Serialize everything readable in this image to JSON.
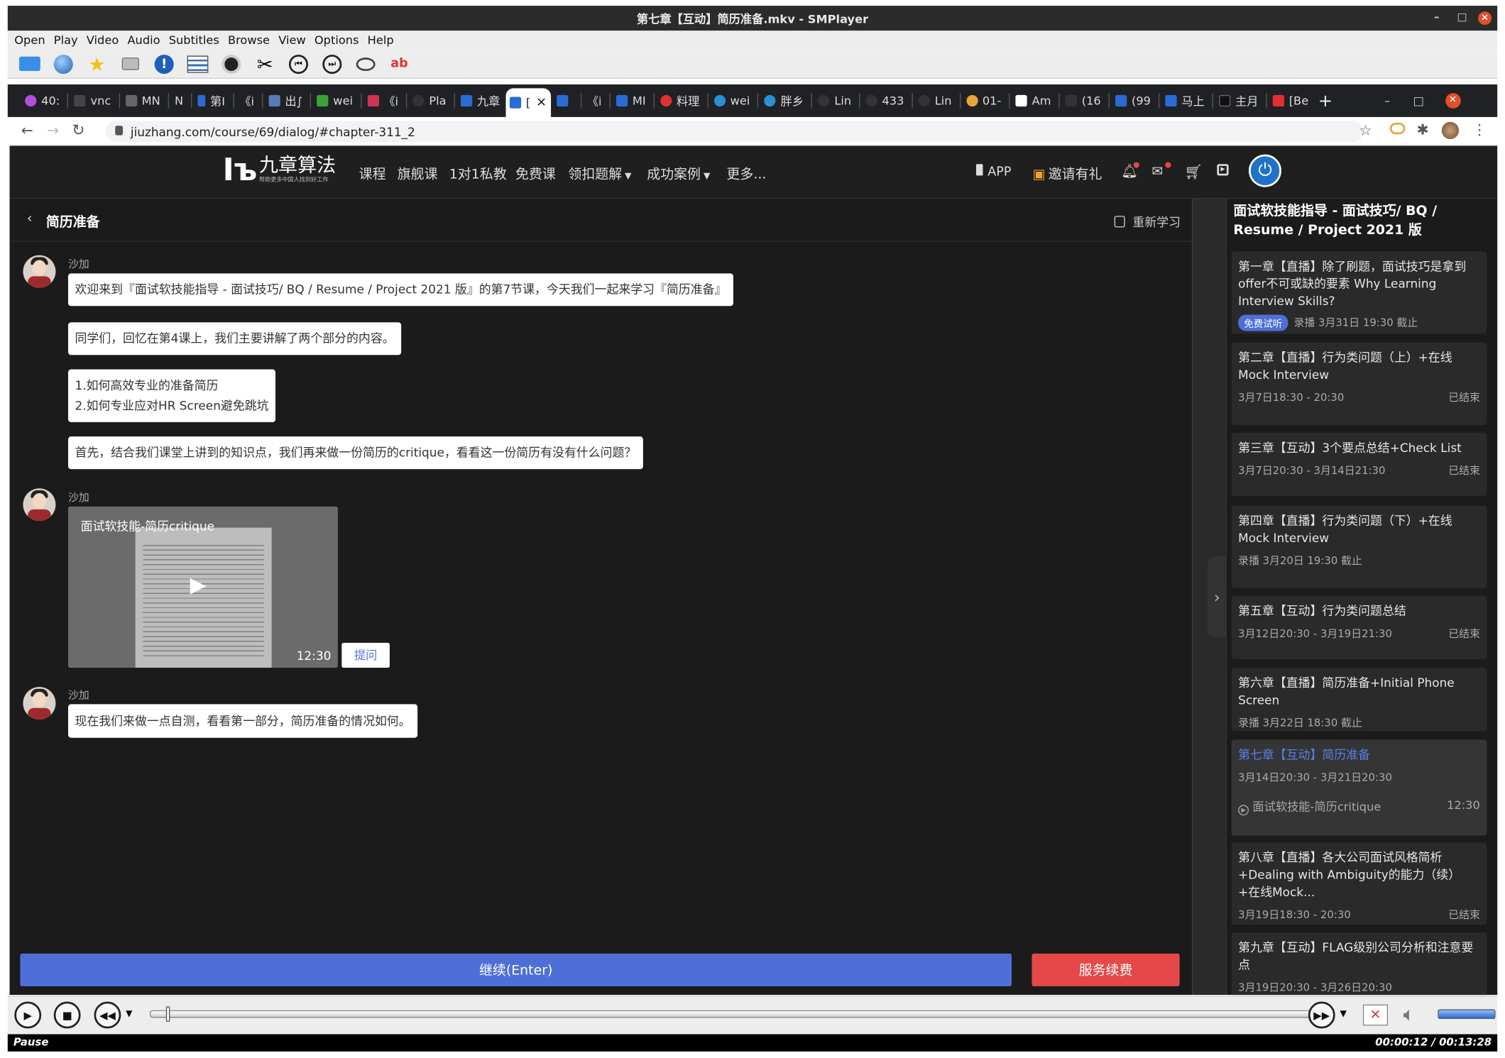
{
  "window": {
    "title": "第七章【互动】简历准备.mkv - SMPlayer"
  },
  "menu": [
    "Open",
    "Play",
    "Video",
    "Audio",
    "Subtitles",
    "Browse",
    "View",
    "Options",
    "Help"
  ],
  "browser": {
    "tabs": [
      {
        "label": "40:",
        "color": "#b44fd8"
      },
      {
        "label": "vnc",
        "color": "#444"
      },
      {
        "label": "MN",
        "color": "#444"
      },
      {
        "label": "N",
        "color": "#222"
      },
      {
        "label": "第Ⅰ",
        "color": "#2b6bd6"
      },
      {
        "label": "《i",
        "color": "#444"
      },
      {
        "label": "出∫",
        "color": "#5a7ab8"
      },
      {
        "label": "wei",
        "color": "#3aa33a"
      },
      {
        "label": "《i",
        "color": "#cc3355"
      },
      {
        "label": "Pla",
        "color": "#444"
      },
      {
        "label": "九章",
        "color": "#2b6bd6"
      },
      {
        "label": "[",
        "color": "#2b6bd6",
        "active": true
      },
      {
        "label": "《i",
        "color": "#2b6bd6"
      },
      {
        "label": "MI",
        "color": "#2b6bd6"
      },
      {
        "label": "料理",
        "color": "#e03030"
      },
      {
        "label": "wei",
        "color": "#2a8fd6"
      },
      {
        "label": "胖乡",
        "color": "#2a8fd6"
      },
      {
        "label": "Lin",
        "color": "#444"
      },
      {
        "label": "433",
        "color": "#444"
      },
      {
        "label": "Lin",
        "color": "#444"
      },
      {
        "label": "01-",
        "color": "#e8a33a"
      },
      {
        "label": "Am",
        "color": "#fff"
      },
      {
        "label": "(16",
        "color": "#444"
      },
      {
        "label": "(99",
        "color": "#2b6bd6"
      },
      {
        "label": "马上",
        "color": "#2b6bd6"
      },
      {
        "label": "主月",
        "color": "#111"
      },
      {
        "label": "[Be",
        "color": "#e03030"
      }
    ],
    "url": "jiuzhang.com/course/69/dialog/#chapter-311_2"
  },
  "site": {
    "logo": "九章算法",
    "logo_sub": "帮助更多中国人找到好工作",
    "nav": [
      "课程",
      "旗舰课",
      "1对1私教",
      "免费课",
      "领扣题解",
      "成功案例",
      "更多..."
    ],
    "app": "APP",
    "invite": "邀请有礼"
  },
  "lesson": {
    "title": "简历准备",
    "restart": "重新学习",
    "speaker": "沙加",
    "messages": [
      "欢迎来到『面试软技能指导 - 面试技巧/ BQ / Resume / Project 2021 版』的第7节课，今天我们一起来学习『简历准备』",
      "同学们，回忆在第4课上，我们主要讲解了两个部分的内容。",
      "1.如何高效专业的准备简历",
      "2.如何专业应对HR Screen避免跳坑",
      "首先，结合我们课堂上讲到的知识点，我们再来做一份简历的critique，看看这一份简历有没有什么问题？"
    ],
    "video": {
      "title": "面试软技能-简历critique",
      "duration": "12:30"
    },
    "ask": "提问",
    "last_message": "现在我们来做一点自测，看看第一部分，简历准备的情况如何。",
    "continue": "继续(Enter)",
    "renew": "服务续费"
  },
  "course": {
    "title": "面试软技能指导 - 面试技巧/ BQ / Resume / Project 2021 版",
    "chapters": [
      {
        "title": "第一章【直播】除了刷题，面试技巧是拿到offer不可或缺的要素 Why Learning Interview Skills?",
        "badge": "免费试听",
        "meta": "录播 3月31日 19:30 截止",
        "status": ""
      },
      {
        "title": "第二章【直播】行为类问题（上）+在线Mock Interview",
        "meta": "3月7日18:30 - 20:30",
        "status": "已结束"
      },
      {
        "title": "第三章【互动】3个要点总结+Check List",
        "meta": "3月7日20:30 - 3月14日21:30",
        "status": "已结束"
      },
      {
        "title": "第四章【直播】行为类问题（下）+在线Mock Interview",
        "meta": "录播 3月20日 19:30 截止",
        "status": ""
      },
      {
        "title": "第五章【互动】行为类问题总结",
        "meta": "3月12日20:30 - 3月19日21:30",
        "status": "已结束"
      },
      {
        "title": "第六章【直播】简历准备+Initial Phone Screen",
        "meta": "录播 3月22日 18:30 截止",
        "status": ""
      },
      {
        "title": "第七章【互动】简历准备",
        "meta": "3月14日20:30 - 3月21日20:30",
        "status": "",
        "sub": "面试软技能-简历critique",
        "sub_time": "12:30",
        "active": true
      },
      {
        "title": "第八章【直播】各大公司面试风格简析+Dealing with Ambiguity的能力（续）+在线Mock...",
        "meta": "3月19日18:30 - 20:30",
        "status": "已结束"
      },
      {
        "title": "第九章【互动】FLAG级别公司分析和注意要点",
        "meta": "3月19日20:30 - 3月26日20:30",
        "status": ""
      }
    ]
  },
  "player": {
    "state": "Pause",
    "time": "00:00:12 / 00:13:28",
    "progress": 0.015
  }
}
